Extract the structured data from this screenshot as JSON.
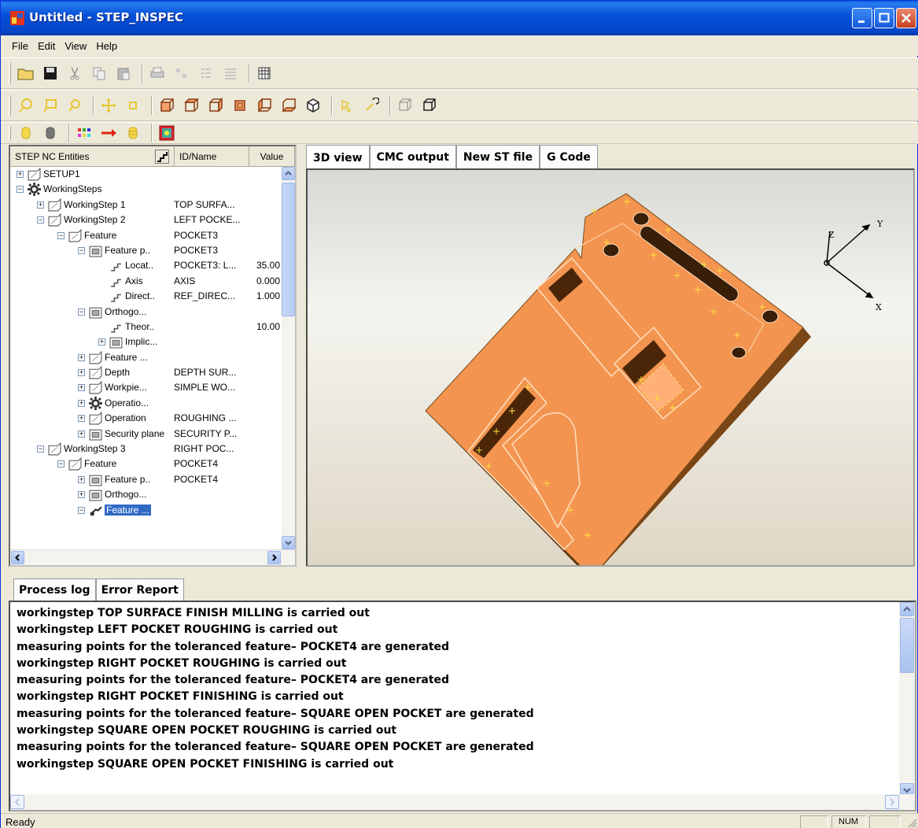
{
  "window": {
    "title": "Untitled - STEP_INSPEC"
  },
  "menu": [
    "File",
    "Edit",
    "View",
    "Help"
  ],
  "tree_panel": {
    "headers": {
      "entities": "STEP NC Entities",
      "id": "ID/Name",
      "value": "Value"
    },
    "rows": [
      {
        "name": "SETUP1",
        "id": "",
        "value": ""
      },
      {
        "name": "WorkingSteps",
        "id": "",
        "value": ""
      },
      {
        "name": "WorkingStep 1",
        "id": "TOP SURFA...",
        "value": ""
      },
      {
        "name": "WorkingStep 2",
        "id": "LEFT POCKE...",
        "value": ""
      },
      {
        "name": "Feature",
        "id": "POCKET3",
        "value": ""
      },
      {
        "name": "Feature p..",
        "id": "POCKET3",
        "value": ""
      },
      {
        "name": "Locat..",
        "id": "POCKET3: L...",
        "value": "35.00"
      },
      {
        "name": "Axis",
        "id": "AXIS",
        "value": "0.000"
      },
      {
        "name": "Direct..",
        "id": "REF_DIREC...",
        "value": "1.000"
      },
      {
        "name": "Orthogo...",
        "id": "",
        "value": ""
      },
      {
        "name": "Theor..",
        "id": "",
        "value": "10.00"
      },
      {
        "name": "Implic...",
        "id": "",
        "value": ""
      },
      {
        "name": "Feature ...",
        "id": "",
        "value": ""
      },
      {
        "name": "Depth",
        "id": "DEPTH SUR...",
        "value": ""
      },
      {
        "name": "Workpie...",
        "id": "SIMPLE WO...",
        "value": ""
      },
      {
        "name": "Operatio...",
        "id": "",
        "value": ""
      },
      {
        "name": "Operation",
        "id": "ROUGHING ...",
        "value": ""
      },
      {
        "name": "Security plane",
        "id": "SECURITY P...",
        "value": ""
      },
      {
        "name": "WorkingStep 3",
        "id": "RIGHT POC...",
        "value": ""
      },
      {
        "name": "Feature",
        "id": "POCKET4",
        "value": ""
      },
      {
        "name": "Feature p..",
        "id": "POCKET4",
        "value": ""
      },
      {
        "name": "Orthogo...",
        "id": "",
        "value": ""
      },
      {
        "name": "Feature ...",
        "id": "",
        "value": ""
      }
    ]
  },
  "view_tabs": [
    "3D view",
    "CMC output",
    "New ST file",
    "G Code"
  ],
  "axes": {
    "x": "X",
    "y": "Y",
    "z": "Z"
  },
  "bottom_tabs": [
    "Process log",
    "Error Report"
  ],
  "log": [
    "workingstep TOP SURFACE FINISH MILLING is carried out",
    "workingstep LEFT POCKET ROUGHING is carried out",
    "measuring points for the toleranced feature– POCKET4 are generated",
    "workingstep RIGHT POCKET ROUGHING is carried out",
    "measuring points for the toleranced feature– POCKET4 are generated",
    "workingstep RIGHT POCKET FINISHING is carried out",
    "measuring points for the toleranced feature– SQUARE OPEN POCKET are generated",
    "workingstep SQUARE OPEN POCKET ROUGHING is carried out",
    "measuring points for the toleranced feature– SQUARE OPEN POCKET are generated",
    "workingstep SQUARE OPEN POCKET FINISHING is carried out"
  ],
  "status": {
    "text": "Ready",
    "num": "NUM"
  },
  "colors": {
    "part": "#f79a4f",
    "part_side": "#8a4a17",
    "title_blue": "#0550d8",
    "selection": "#316ac5"
  }
}
